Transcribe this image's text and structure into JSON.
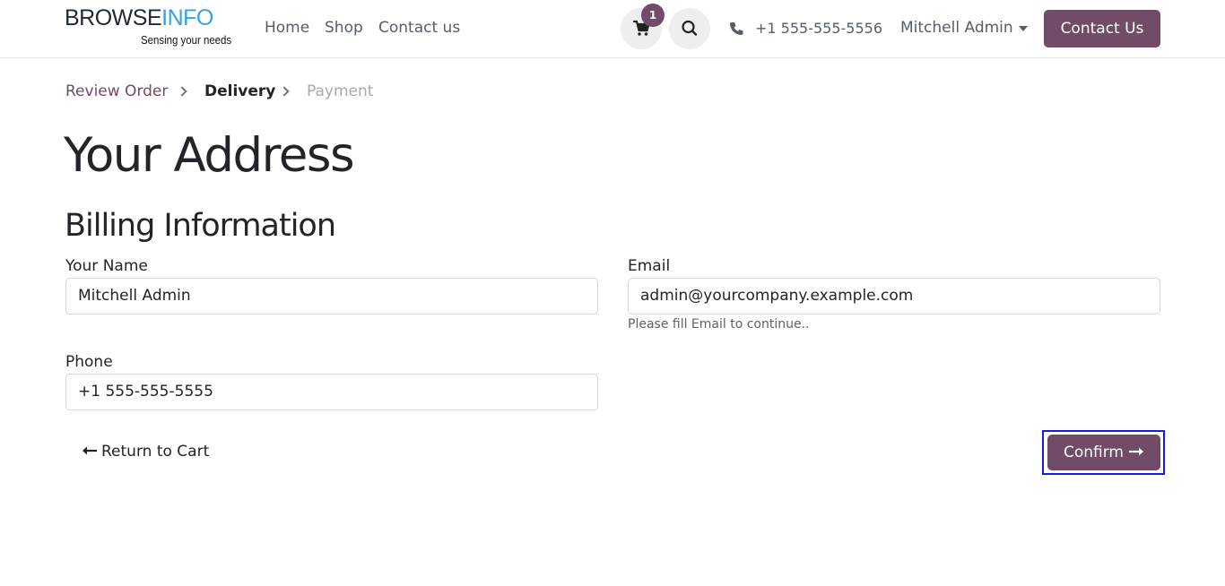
{
  "brand": {
    "logo_part1": "BROWSE",
    "logo_part2": "INFO",
    "tagline": "Sensing your needs",
    "primary_color": "#714b67",
    "logo_accent_color": "#3aa0dc"
  },
  "header": {
    "nav": [
      "Home",
      "Shop",
      "Contact us"
    ],
    "cart_count": "1",
    "cart_icon": "shopping-cart-icon",
    "search_icon": "search-icon",
    "phone_icon": "phone-icon",
    "phone": "+1 555-555-5556",
    "user_name": "Mitchell Admin",
    "contact_button": "Contact Us"
  },
  "breadcrumb": {
    "steps": [
      "Review Order",
      "Delivery",
      "Payment"
    ],
    "active_step": "Delivery"
  },
  "page": {
    "title": "Your Address",
    "section_title": "Billing Information"
  },
  "form": {
    "name_label": "Your Name",
    "name_value": "Mitchell Admin",
    "email_label": "Email",
    "email_value": "admin@yourcompany.example.com",
    "email_help": "Please fill Email to continue..",
    "phone_label": "Phone",
    "phone_value": "+1 555-555-5555"
  },
  "actions": {
    "return_label": "Return to Cart",
    "confirm_label": "Confirm"
  }
}
